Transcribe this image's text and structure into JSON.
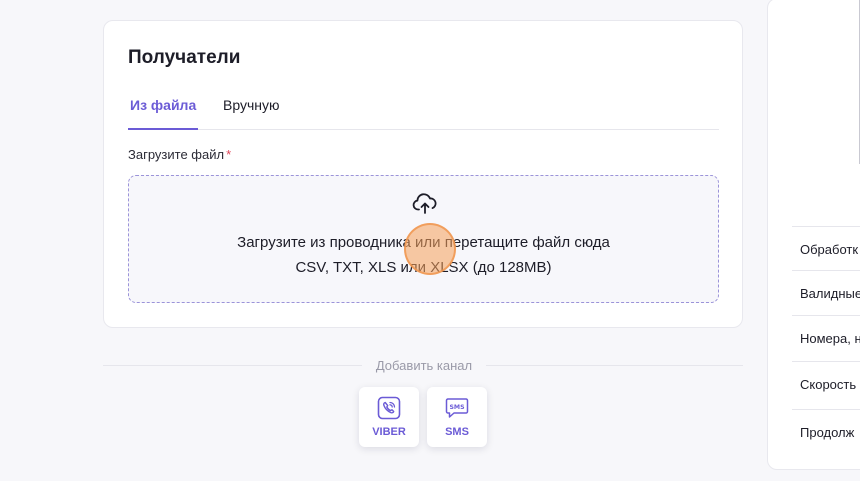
{
  "recipients": {
    "title": "Получатели",
    "tabs": [
      "Из файла",
      "Вручную"
    ],
    "upload_label": "Загрузите файл",
    "required_mark": "*",
    "dropzone_line1": "Загрузите из проводника или перетащите файл сюда",
    "dropzone_line2": "CSV, TXT, XLS или XLSX (до 128MB)",
    "icon": "cloud-upload-icon"
  },
  "channels": {
    "add_label": "Добавить канал",
    "items": [
      {
        "label": "VIBER",
        "icon": "viber-icon"
      },
      {
        "label": "SMS",
        "icon": "sms-icon"
      }
    ]
  },
  "side_panel": {
    "metrics": [
      "Обработк",
      "Валидные",
      "Номера, н",
      "Скорость",
      "Продолж"
    ]
  },
  "colors": {
    "accent": "#6b5bd6",
    "required": "#e0475a",
    "background": "#f7f7fa"
  }
}
